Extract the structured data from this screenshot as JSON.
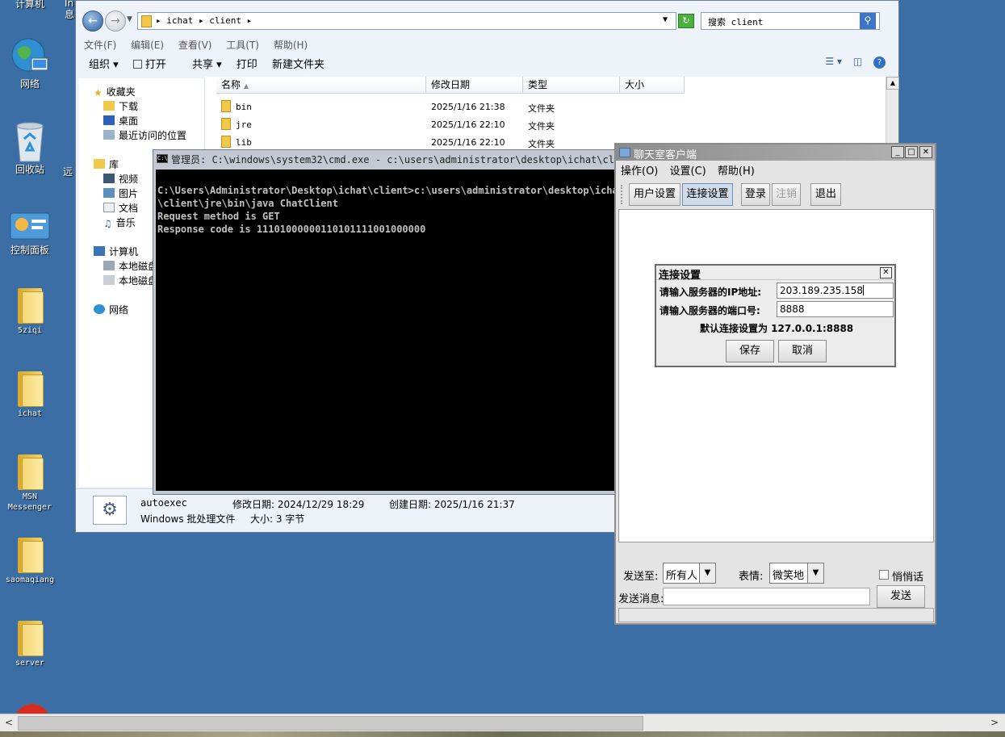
{
  "desktop": {
    "icons": [
      "计算机",
      "网络",
      "回收站",
      "控制面板",
      "5ziqi",
      "ichat",
      "MSN Messenger",
      "saomaqiang",
      "server"
    ],
    "partial_labels": [
      "In",
      "息",
      "远"
    ]
  },
  "explorer": {
    "breadcrumb": "▸ ichat ▸ client ▸",
    "search_placeholder": "搜索 client",
    "menu": [
      "文件(F)",
      "编辑(E)",
      "查看(V)",
      "工具(T)",
      "帮助(H)"
    ],
    "toolbar": [
      "组织 ▾",
      "打开",
      "共享 ▾",
      "打印",
      "新建文件夹"
    ],
    "nav": {
      "favorites": "收藏夹",
      "downloads": "下载",
      "desktop": "桌面",
      "recent": "最近访问的位置",
      "libraries": "库",
      "videos": "视频",
      "pictures": "图片",
      "documents": "文档",
      "music": "音乐",
      "computer": "计算机",
      "disk1": "本地磁盘",
      "disk2": "本地磁盘",
      "network": "网络"
    },
    "columns": [
      "名称",
      "修改日期",
      "类型",
      "大小"
    ],
    "files": [
      {
        "name": "bin",
        "date": "2025/1/16 21:38",
        "type": "文件夹"
      },
      {
        "name": "jre",
        "date": "2025/1/16 22:10",
        "type": "文件夹"
      },
      {
        "name": "lib",
        "date": "2025/1/16 22:10",
        "type": "文件夹"
      }
    ],
    "details": {
      "name": "autoexec",
      "kind": "Windows 批处理文件",
      "modified": "修改日期: 2024/12/29 18:29",
      "created": "创建日期: 2025/1/16 21:37",
      "size": "大小: 3 字节"
    }
  },
  "cmd": {
    "title": "管理员: C:\\windows\\system32\\cmd.exe - c:\\users\\administrator\\desktop\\ichat\\client",
    "lines": "C:\\Users\\Administrator\\Desktop\\ichat\\client>c:\\users\\administrator\\desktop\\ichat\n\\client\\jre\\bin\\java ChatClient\nRequest method is GET\nResponse code is 11101000000110101111001000000"
  },
  "chat": {
    "title": "聊天室客户端",
    "menu": [
      "操作(O)",
      "设置(C)",
      "帮助(H)"
    ],
    "buttons": {
      "user_settings": "用户设置",
      "connect_settings": "连接设置",
      "login": "登录",
      "logout": "注销",
      "exit": "退出"
    },
    "send_to_label": "发送至:",
    "send_to_value": "所有人",
    "emotion_label": "表情:",
    "emotion_value": "微笑地",
    "whisper_label": "悄悄话",
    "message_label": "发送消息:",
    "send_button": "发送"
  },
  "dialog": {
    "title": "连接设置",
    "ip_label": "请输入服务器的IP地址:",
    "ip_value": "203.189.235.158",
    "port_label": "请输入服务器的端口号:",
    "port_value": "8888",
    "default_text": "默认连接设置为 127.0.0.1:8888",
    "save": "保存",
    "cancel": "取消"
  }
}
